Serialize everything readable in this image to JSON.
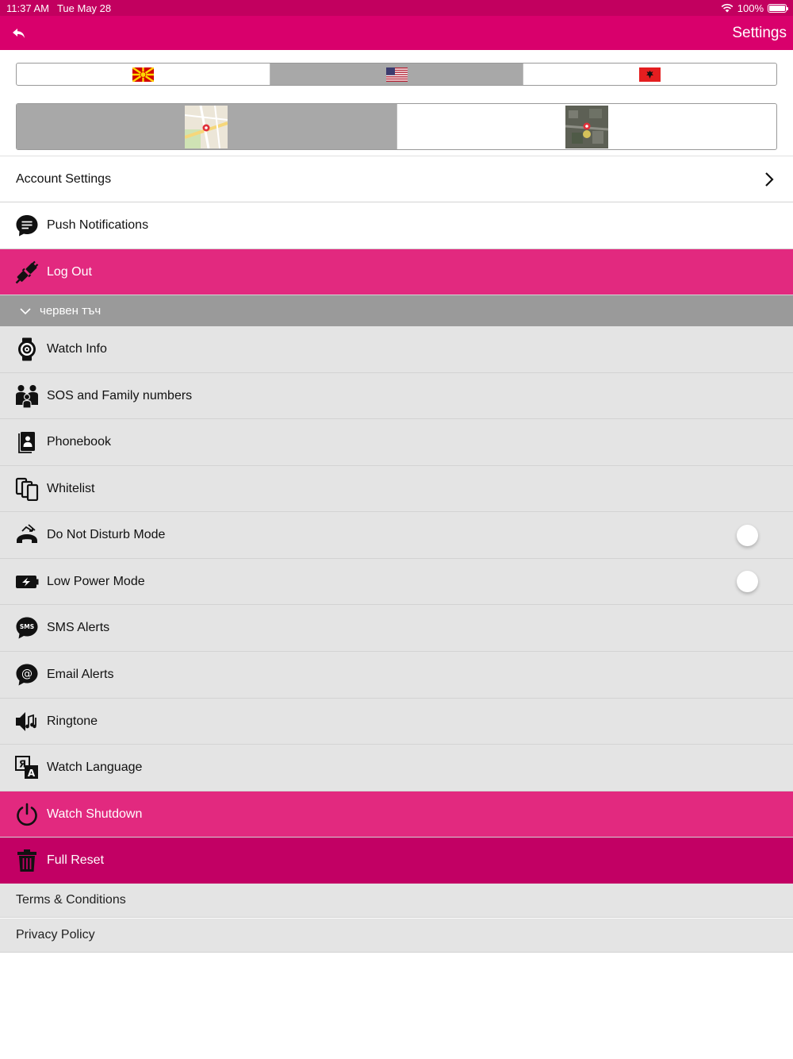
{
  "status_bar": {
    "time": "11:37 AM",
    "date": "Tue May 28",
    "battery": "100%",
    "battery_level": 1.0
  },
  "nav": {
    "title": "Settings",
    "back_icon": "back-arrow-icon"
  },
  "language_selector": {
    "options": [
      {
        "flag": "macedonia-flag",
        "selected": false
      },
      {
        "flag": "usa-flag",
        "selected": true
      },
      {
        "flag": "albania-flag",
        "selected": false
      }
    ]
  },
  "map_selector": {
    "options": [
      {
        "type": "street-map",
        "selected": true
      },
      {
        "type": "satellite-map",
        "selected": false
      }
    ]
  },
  "account": {
    "account_settings": "Account Settings",
    "push_notifications": "Push Notifications",
    "log_out": "Log Out"
  },
  "device": {
    "name": "червен тъч",
    "items": [
      {
        "label": "Watch Info",
        "icon": "watch-icon"
      },
      {
        "label": "SOS and Family numbers",
        "icon": "family-icon"
      },
      {
        "label": "Phonebook",
        "icon": "phonebook-icon"
      },
      {
        "label": "Whitelist",
        "icon": "whitelist-icon"
      },
      {
        "label": "Do Not Disturb Mode",
        "icon": "do-not-disturb-icon",
        "toggle": false
      },
      {
        "label": "Low Power Mode",
        "icon": "low-power-icon",
        "toggle": false
      },
      {
        "label": "SMS Alerts",
        "icon": "sms-icon"
      },
      {
        "label": "Email Alerts",
        "icon": "email-icon"
      },
      {
        "label": "Ringtone",
        "icon": "ringtone-icon"
      },
      {
        "label": "Watch Language",
        "icon": "language-icon"
      }
    ],
    "watch_shutdown": "Watch Shutdown",
    "full_reset": "Full Reset"
  },
  "footer": {
    "terms": "Terms & Conditions",
    "privacy": "Privacy Policy"
  },
  "colors": {
    "status_bar": "#c2005f",
    "nav_bar": "#d9006c",
    "pink_row": "#e2297f",
    "magenta_row": "#c20064",
    "group_header": "#9a9a9a",
    "grey_row": "#e4e4e4"
  }
}
